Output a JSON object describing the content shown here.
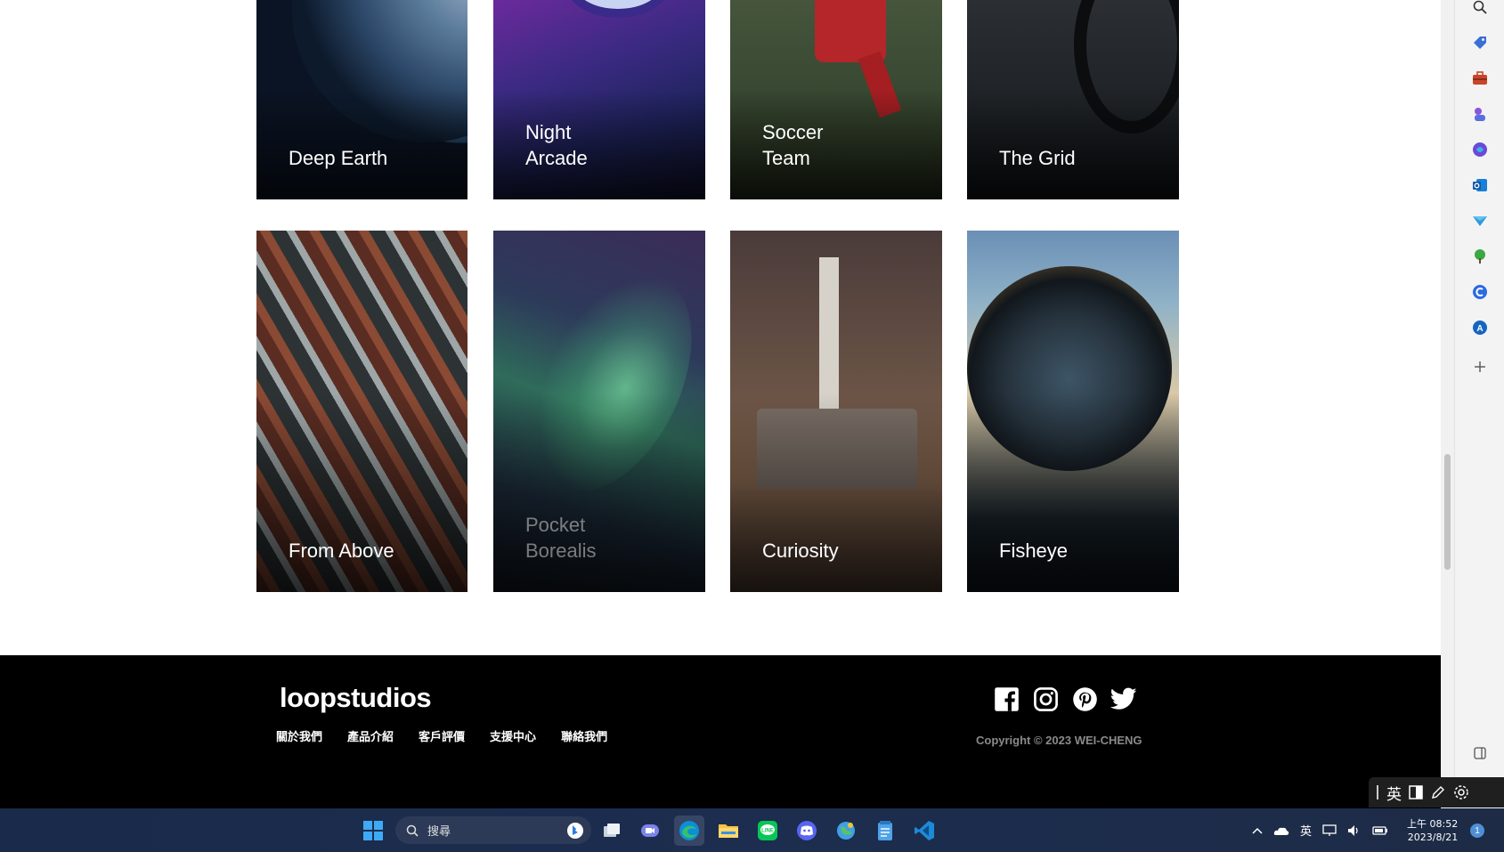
{
  "gallery": {
    "cards": [
      {
        "id": "deep-earth",
        "title": "Deep Earth"
      },
      {
        "id": "night-arcade",
        "title": "Night Arcade"
      },
      {
        "id": "soccer-team",
        "title": "Soccer Team"
      },
      {
        "id": "the-grid",
        "title": "The Grid"
      },
      {
        "id": "from-above",
        "title": "From Above"
      },
      {
        "id": "pocket-borealis",
        "title": "Pocket Borealis"
      },
      {
        "id": "curiosity",
        "title": "Curiosity"
      },
      {
        "id": "fisheye",
        "title": "Fisheye"
      }
    ]
  },
  "footer": {
    "logo": "loopstudios",
    "nav": [
      "關於我們",
      "產品介紹",
      "客戶評價",
      "支援中心",
      "聯絡我們"
    ],
    "social": [
      "facebook-icon",
      "instagram-icon",
      "pinterest-icon",
      "twitter-icon"
    ],
    "copyright": "Copyright © 2023 WEI-CHENG"
  },
  "edge_sidebar": {
    "icons": [
      "search-icon",
      "tag-icon",
      "briefcase-icon",
      "games-icon",
      "copilot-icon",
      "outlook-icon",
      "send-icon",
      "tree-icon",
      "c-icon",
      "a-icon",
      "add-icon",
      "sidebar-toggle-icon"
    ]
  },
  "ime_bar": {
    "lang": "英",
    "icons": [
      "layout-icon",
      "pencil-icon",
      "settings-icon"
    ]
  },
  "taskbar": {
    "search_placeholder": "搜尋",
    "tray_lang": "英",
    "clock_time": "上午 08:52",
    "clock_date": "2023/8/21",
    "notification_count": "1",
    "accent": "#0078d4"
  }
}
